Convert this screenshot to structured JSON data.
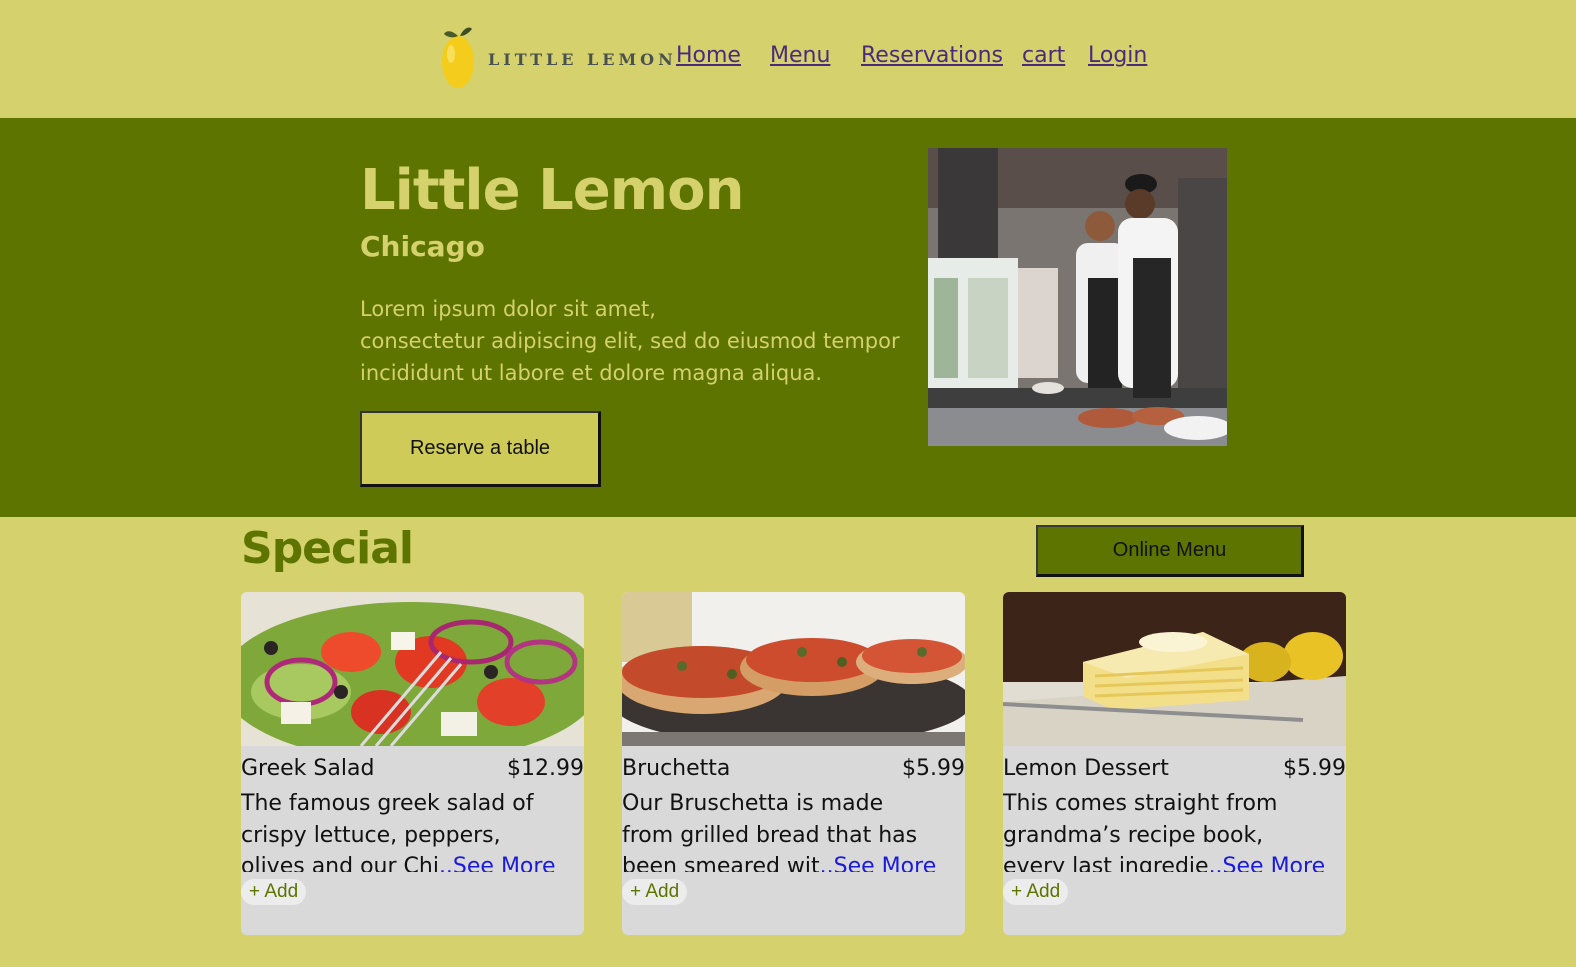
{
  "header": {
    "logo_text": "LITTLE LEMON",
    "nav": [
      "Home",
      "Menu",
      "Reservations",
      "cart",
      "Login"
    ]
  },
  "hero": {
    "title": "Little Lemon",
    "subtitle": "Chicago",
    "description": [
      "Lorem ipsum dolor sit amet,",
      "consectetur adipiscing elit, sed do eiusmod tempor",
      "incididunt ut labore et dolore magna aliqua."
    ],
    "reserve_label": "Reserve a table"
  },
  "specials": {
    "title": "Special",
    "online_menu_label": "Online Menu",
    "see_more_label": "..See More",
    "add_label": "+ Add",
    "items": [
      {
        "name": "Greek Salad",
        "price": "$12.99",
        "desc": [
          "The famous greek salad of",
          "crispy lettuce, peppers,",
          "olives and our Chi"
        ]
      },
      {
        "name": "Bruchetta",
        "price": "$5.99",
        "desc": [
          "Our Bruschetta is made",
          "from grilled bread that has",
          "been smeared wit"
        ]
      },
      {
        "name": "Lemon Dessert",
        "price": "$5.99",
        "desc": [
          "This comes straight from",
          "grandma’s recipe book,",
          "every last ingredie"
        ]
      }
    ]
  },
  "colors": {
    "background": "#d5d16c",
    "hero": "#5d7400",
    "card": "#d9d9d9",
    "link": "#1a1add",
    "nav_link": "#4b2a7d"
  }
}
